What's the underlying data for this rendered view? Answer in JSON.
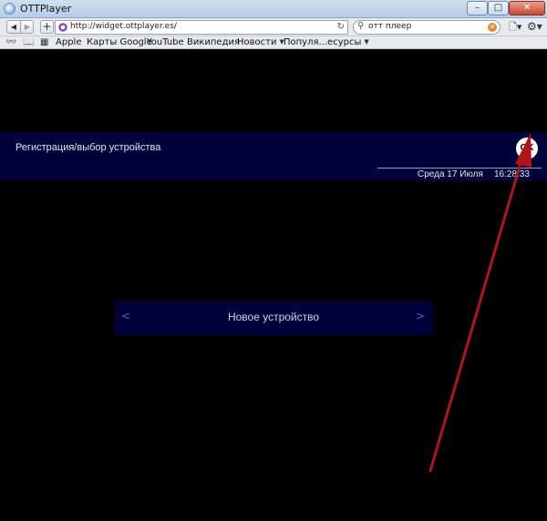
{
  "window": {
    "title": "OTTPlayer",
    "minimize_glyph": "–",
    "maximize_glyph": "□",
    "close_glyph": "✕"
  },
  "toolbar": {
    "back_glyph": "◀",
    "forward_glyph": "▶",
    "add_glyph": "+",
    "url": "http://widget.ottplayer.es/",
    "reload_glyph": "↻",
    "search_icon_glyph": "⚲",
    "search_value": "отт плеер",
    "page_menu_glyph": "🗋▾",
    "settings_menu_glyph": "⚙▾"
  },
  "bookmarks": {
    "reading_list_glyph": "👓",
    "book_glyph": "📖",
    "grid_glyph": "▦",
    "items": [
      {
        "label": "Apple"
      },
      {
        "label": "Карты Google"
      },
      {
        "label": "YouTube"
      },
      {
        "label": "Википедия"
      },
      {
        "label": "Новости",
        "dropdown": "▼"
      },
      {
        "label": "Популя...есурсы",
        "dropdown": "▼"
      }
    ]
  },
  "page": {
    "title": "Регистрация/выбор устройства",
    "date": "Среда 17 Июля",
    "time": "16:28:33",
    "ok_label": "OK",
    "device": {
      "prev_glyph": "<",
      "next_glyph": ">",
      "label": "Новое устройство"
    }
  },
  "colors": {
    "band": "#00003a",
    "arrow_accent": "#4a5fd0",
    "annotation_arrow": "#b0151b"
  }
}
